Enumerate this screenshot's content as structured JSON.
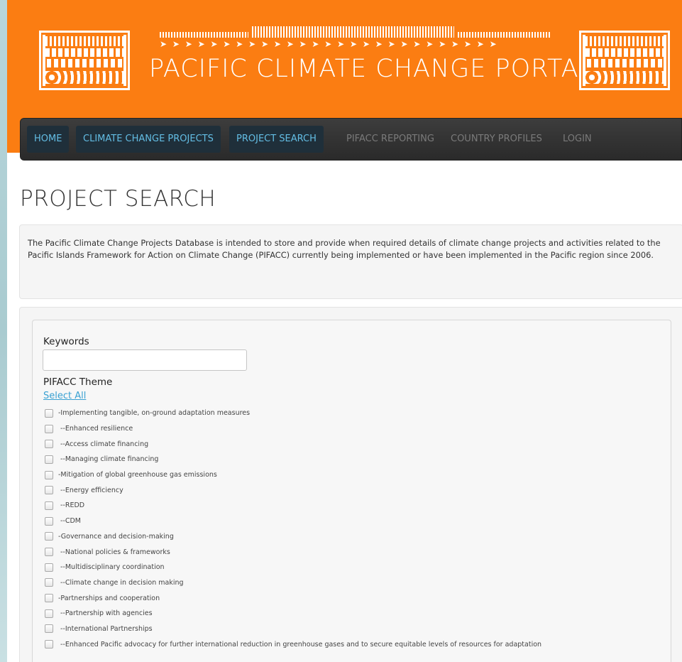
{
  "header": {
    "site_title": "PACIFIC CLIMATE CHANGE PORTAL",
    "brand_color": "#fb7d12",
    "deco_arrows": "➤ ➤ ➤ ➤ ➤ ➤ ➤ ➤ ➤ ➤ ➤ ➤ ➤ ➤ ➤ ➤ ➤ ➤ ➤ ➤ ➤ ➤ ➤ ➤ ➤ ➤ ➤"
  },
  "nav": {
    "items": [
      {
        "label": "HOME"
      },
      {
        "label": "CLIMATE CHANGE PROJECTS"
      },
      {
        "label": "PROJECT SEARCH"
      },
      {
        "label": "PIFACC REPORTING"
      },
      {
        "label": "COUNTRY PROFILES"
      },
      {
        "label": "LOGIN"
      }
    ]
  },
  "page": {
    "title": "PROJECT SEARCH",
    "intro": "The Pacific Climate Change Projects Database is intended to store and provide when required details of climate change projects and activities related to the Pacific Islands Framework for Action on Climate Change (PIFACC) currently being implemented or have been implemented in the Pacific region since 2006."
  },
  "search": {
    "keywords_label": "Keywords",
    "keywords_value": "",
    "theme_label": "PIFACC Theme",
    "select_all": "Select All",
    "themes": [
      "-Implementing tangible, on-ground adaptation measures",
      "--Enhanced resilience",
      "--Access climate financing",
      "--Managing climate financing",
      "-Mitigation of global greenhouse gas emissions",
      "--Energy efficiency",
      "--REDD",
      "--CDM",
      "-Governance and decision-making",
      "--National policies & frameworks",
      "--Multidisciplinary coordination",
      "--Climate change in decision making",
      "-Partnerships and cooperation",
      "--Partnership with agencies",
      "--International Partnerships",
      "--Enhanced Pacific advocacy for further international reduction in greenhouse gases and to secure equitable levels of resources for adaptation"
    ]
  }
}
